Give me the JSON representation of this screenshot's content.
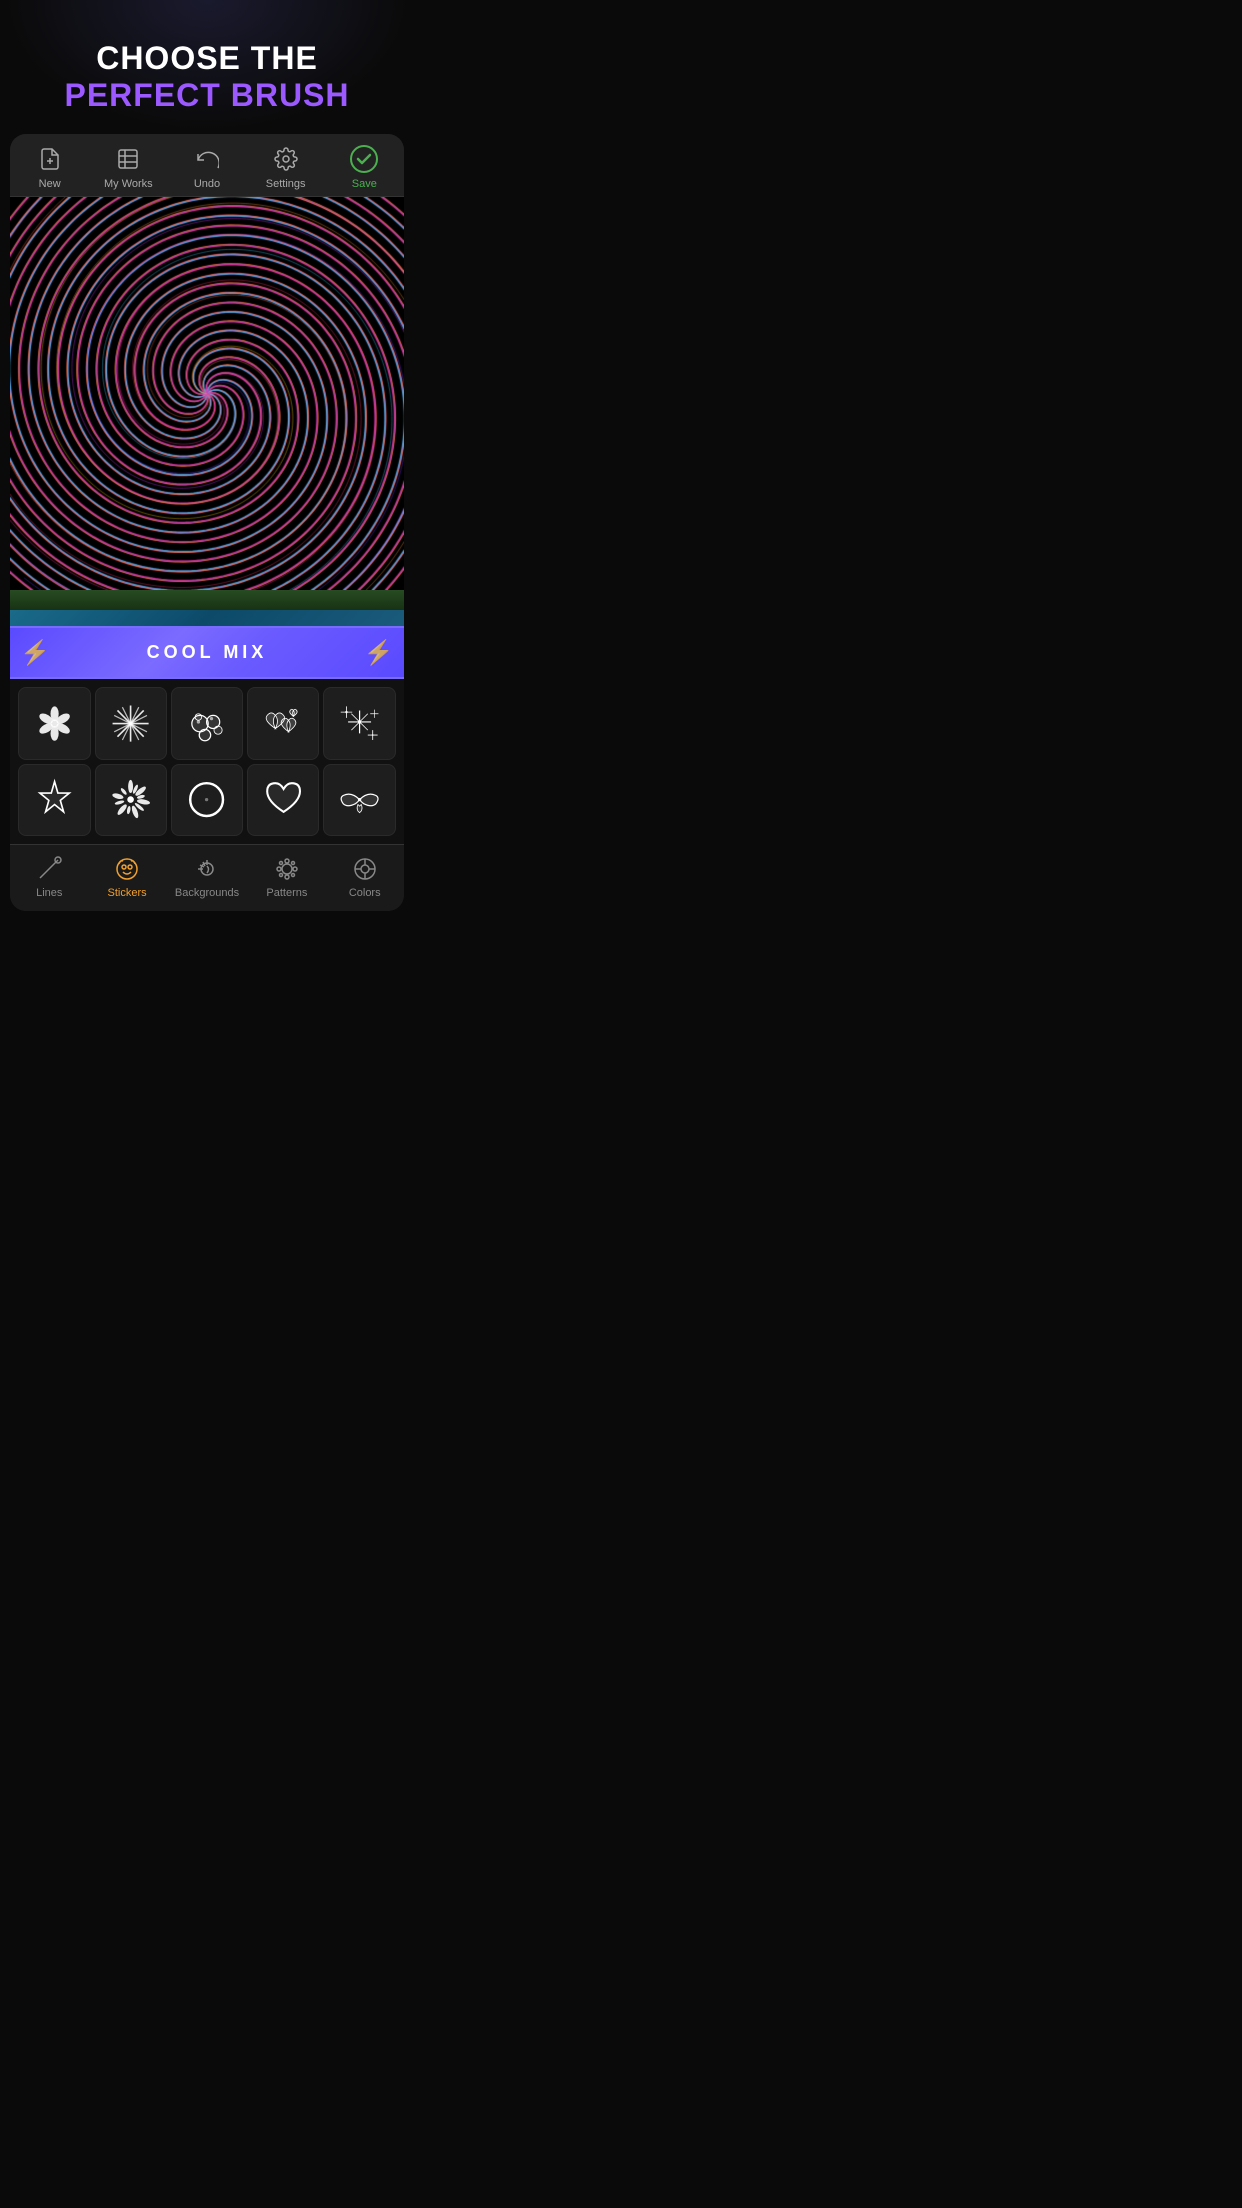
{
  "header": {
    "line1": "CHOOSE THE",
    "line2": "PERFECT BRUSH"
  },
  "toolbar": {
    "items": [
      {
        "id": "new",
        "label": "New",
        "icon": "new-file-icon"
      },
      {
        "id": "my-works",
        "label": "My Works",
        "icon": "gallery-icon"
      },
      {
        "id": "undo",
        "label": "Undo",
        "icon": "undo-icon"
      },
      {
        "id": "settings",
        "label": "Settings",
        "icon": "settings-icon"
      },
      {
        "id": "save",
        "label": "Save",
        "icon": "save-icon",
        "active": true
      }
    ]
  },
  "brush_banner": {
    "label": "COOL MIX"
  },
  "brush_grid": {
    "row1": [
      {
        "id": "brush-flower",
        "label": "Flower brush"
      },
      {
        "id": "brush-star-burst",
        "label": "Star burst brush"
      },
      {
        "id": "brush-bubbles",
        "label": "Bubbles brush"
      },
      {
        "id": "brush-hearts",
        "label": "Hearts brush"
      },
      {
        "id": "brush-sparkles",
        "label": "Sparkles brush"
      }
    ],
    "row2": [
      {
        "id": "brush-star",
        "label": "Star brush"
      },
      {
        "id": "brush-splat",
        "label": "Splat brush"
      },
      {
        "id": "brush-circle",
        "label": "Circle brush"
      },
      {
        "id": "brush-heart",
        "label": "Heart brush"
      },
      {
        "id": "brush-wings",
        "label": "Wings brush"
      }
    ]
  },
  "bottom_nav": {
    "items": [
      {
        "id": "lines",
        "label": "Lines",
        "icon": "lines-icon",
        "active": false
      },
      {
        "id": "stickers",
        "label": "Stickers",
        "icon": "stickers-icon",
        "active": true
      },
      {
        "id": "backgrounds",
        "label": "Backgrounds",
        "icon": "backgrounds-icon",
        "active": false
      },
      {
        "id": "patterns",
        "label": "Patterns",
        "icon": "patterns-icon",
        "active": false
      },
      {
        "id": "colors",
        "label": "Colors",
        "icon": "colors-icon",
        "active": false
      }
    ]
  }
}
